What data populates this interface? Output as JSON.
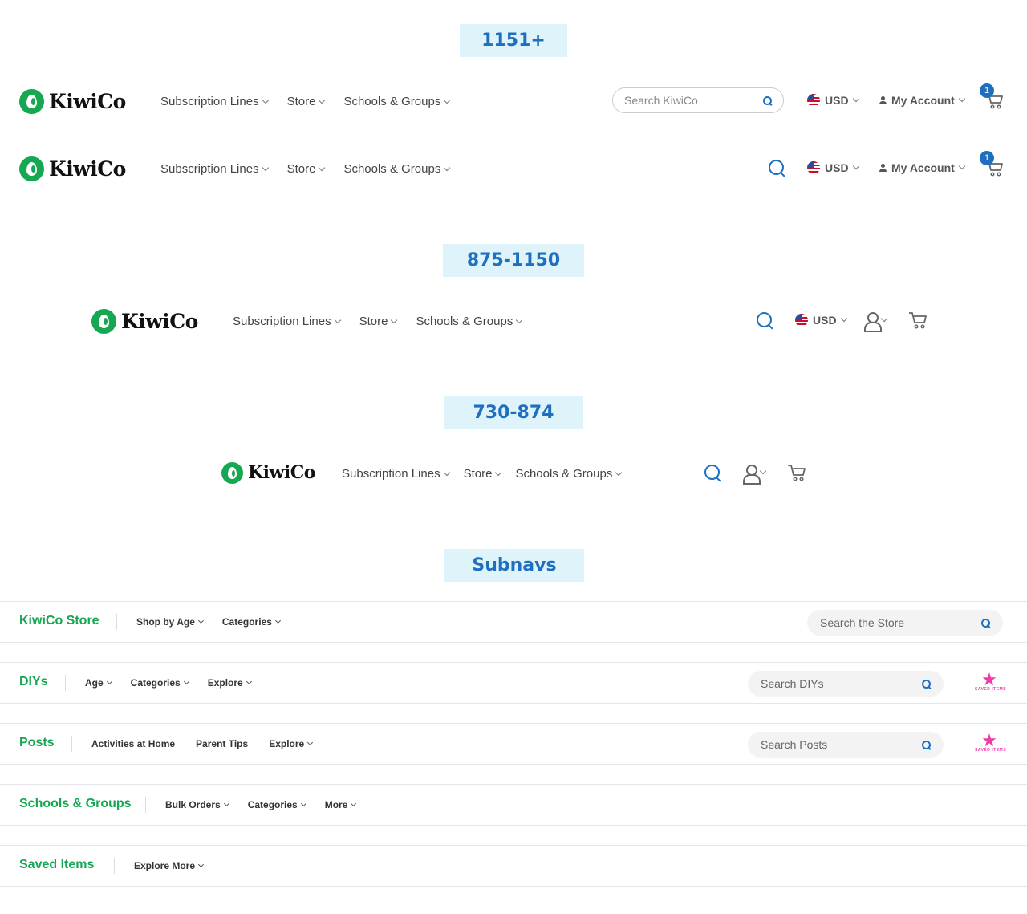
{
  "sections": {
    "wide": "1151+",
    "medium": "875-1150",
    "narrow": "730-874",
    "subnavs": "Subnavs"
  },
  "brand": {
    "name": "KiwiCo"
  },
  "nav": {
    "subscription_lines": "Subscription Lines",
    "store": "Store",
    "schools_groups": "Schools & Groups"
  },
  "header": {
    "search_placeholder": "Search KiwiCo",
    "currency": "USD",
    "account": "My Account",
    "cart_count": "1"
  },
  "subnavs": {
    "store": {
      "title": "KiwiCo Store",
      "links": [
        "Shop by Age",
        "Categories"
      ],
      "search": "Search the Store"
    },
    "diys": {
      "title": "DIYs",
      "links": [
        "Age",
        "Categories",
        "Explore"
      ],
      "search": "Search DIYs",
      "saved": "SAVED ITEMS"
    },
    "posts": {
      "title": "Posts",
      "links": [
        "Activities at Home",
        "Parent Tips",
        "Explore"
      ],
      "search": "Search Posts",
      "saved": "SAVED ITEMS"
    },
    "schools": {
      "title": "Schools & Groups",
      "links": [
        "Bulk Orders",
        "Categories",
        "More"
      ]
    },
    "saved": {
      "title": "Saved Items",
      "links": [
        "Explore More"
      ]
    }
  },
  "colors": {
    "brand_green": "#15a751",
    "link_blue": "#1e6fbf",
    "label_bg": "#dff3fa",
    "saved_pink": "#ef3aa9"
  }
}
